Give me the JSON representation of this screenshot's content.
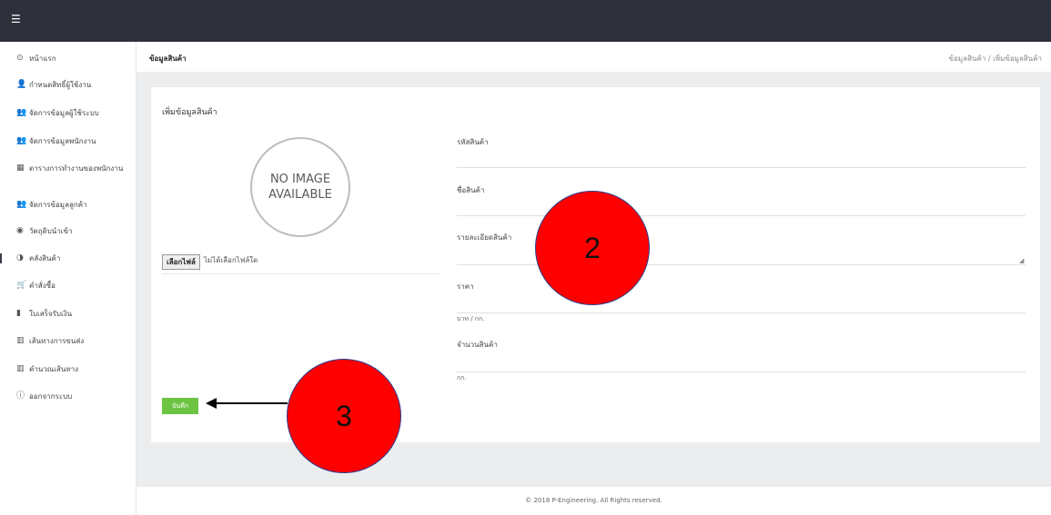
{
  "topbar": {
    "menu_icon": "☰"
  },
  "sidebar": {
    "items": [
      {
        "icon": "⊙",
        "label": "หน้าแรก"
      },
      {
        "icon": "👤",
        "label": "กำหนดสิทธิ์ผู้ใช้งาน"
      },
      {
        "icon": "👥",
        "label": "จัดการข้อมูลผู้ใช้ระบบ"
      },
      {
        "icon": "👥",
        "label": "จัดการข้อมูลพนักงาน"
      },
      {
        "icon": "▦",
        "label": "ตารางการทำงานของพนักงาน"
      },
      {
        "icon": "👥",
        "label": "จัดการข้อมูลลูกค้า"
      },
      {
        "icon": "◉",
        "label": "วัตถุดิบนำเข้า"
      },
      {
        "icon": "◑",
        "label": "คลังสินค้า"
      },
      {
        "icon": "🛒",
        "label": "คำสั่งซื้อ"
      },
      {
        "icon": "▮",
        "label": "ใบเสร็จรับเงิน"
      },
      {
        "icon": "▥",
        "label": "เส้นทางการขนส่ง"
      },
      {
        "icon": "▥",
        "label": "คำนวณเส้นทาง"
      },
      {
        "icon": "ⓘ",
        "label": "ออกจากระบบ"
      }
    ]
  },
  "header": {
    "title": "ข้อมูลสินค้า",
    "breadcrumb": "ข้อมูลสินค้า  /  เพิ่มข้อมูลสินค้า"
  },
  "form": {
    "title": "เพิ่มข้อมูลสินค้า",
    "image_placeholder_line1": "NO IMAGE",
    "image_placeholder_line2": "AVAILABLE",
    "file_button": "เลือกไฟล์",
    "file_none": "ไม่ได้เลือกไฟล์ใด",
    "fields": {
      "code_label": "รหัสสินค้า",
      "name_label": "ชื่อสินค้า",
      "detail_label": "รายละเอียดสินค้า",
      "price_label": "ราคา",
      "price_unit": "บาท / กก.",
      "qty_label": "จำนวนสินค้า",
      "qty_unit": "กก."
    },
    "save_button": "บันทึก"
  },
  "annotations": {
    "marker_2": "2",
    "marker_3": "3"
  },
  "footer": {
    "text": "© 2018 P-Engineering. All Rights reserved."
  },
  "colors": {
    "topbar": "#2e313b",
    "save": "#6dc342",
    "marker": "#fe0000"
  }
}
